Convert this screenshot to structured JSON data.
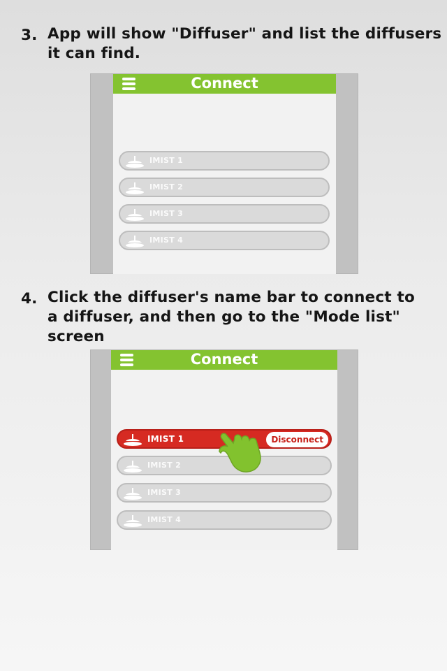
{
  "steps": [
    {
      "number": "3.",
      "lines": [
        "App will show \"Diffuser\" and list the diffusers",
        "it can find."
      ]
    },
    {
      "number": "4.",
      "lines": [
        "Click the diffuser's name bar to connect to",
        "a diffuser, and then go to the \"Mode list\"",
        "screen"
      ]
    }
  ],
  "screen1": {
    "title": "Connect",
    "menu_icon": "hamburger-menu-icon",
    "devices": [
      "IMIST 1",
      "IMIST 2",
      "IMIST 3",
      "IMIST 4"
    ]
  },
  "screen2": {
    "title": "Connect",
    "menu_icon": "hamburger-menu-icon",
    "devices": [
      {
        "label": "IMIST 1",
        "state": "connected",
        "action": "Disconnect"
      },
      {
        "label": "IMIST 2"
      },
      {
        "label": "IMIST 3"
      },
      {
        "label": "IMIST 4"
      }
    ],
    "pointer_icon": "tapping-hand-icon"
  },
  "colors": {
    "accent": "#84c330",
    "active": "#d62a22",
    "device_bar": "#dadada",
    "frame": "#c1c1c1"
  }
}
